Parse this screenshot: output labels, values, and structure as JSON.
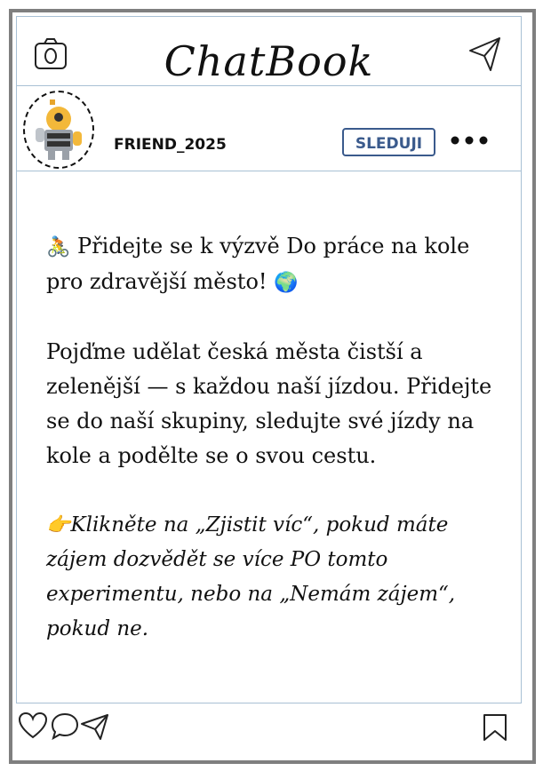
{
  "app": {
    "title": "ChatBook"
  },
  "header": {
    "camera_icon": "camera-icon",
    "send_icon": "send-icon"
  },
  "profile": {
    "username": "FRIEND_2025",
    "follow_label": "SLEDUJI",
    "avatar_icon": "robot-avatar",
    "more_icon": "more-dots-icon"
  },
  "post": {
    "line1_emoji": "🚴",
    "line1_text": "Přidejte se k výzvě Do práce na kole pro zdravější město!",
    "line1_emoji_end": "🌍",
    "line2_text": "Pojďme udělat česká města čistší a zelenější — s každou naší jízdou. Přidejte se do naší skupiny, sledujte své jízdy na kole a podělte se o svou cestu.",
    "cta_emoji": "👉",
    "cta_text": "Klikněte na „Zjistit víc“, pokud máte zájem dozvědět se více PO tomto experimentu, nebo na „Nemám zájem“, pokud ne."
  },
  "footer": {
    "like_icon": "heart-icon",
    "comment_icon": "comment-icon",
    "share_icon": "send-icon",
    "save_icon": "bookmark-icon"
  },
  "colors": {
    "frame": "#7f7f7f",
    "divider": "#a8c0d4",
    "accent": "#3a5a8c"
  }
}
